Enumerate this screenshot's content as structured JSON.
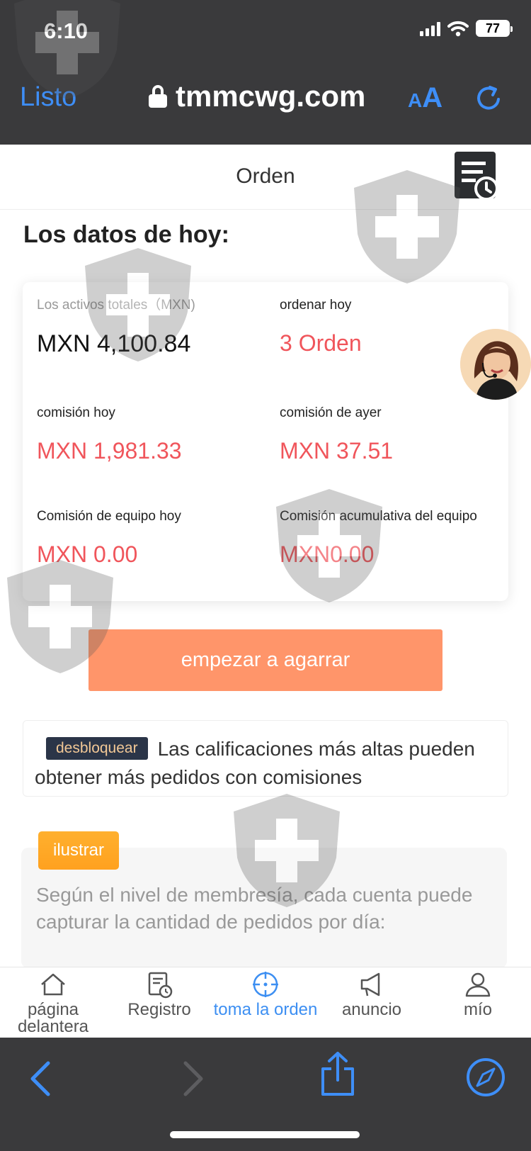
{
  "status_bar": {
    "time": "6:10",
    "battery": "77"
  },
  "browser": {
    "done_label": "Listo",
    "url": "tmmcwg.com",
    "text_size_label_small": "A",
    "text_size_label_big": "A"
  },
  "header": {
    "title": "Orden"
  },
  "section_title": "Los datos de hoy:",
  "stats": {
    "total_assets": {
      "label": "Los activos totales（MXN)",
      "value": "MXN 4,100.84"
    },
    "orders_today": {
      "label": "ordenar hoy",
      "value": "3 Orden"
    },
    "commission_today": {
      "label": "comisión hoy",
      "value": "MXN 1,981.33"
    },
    "commission_yesterday": {
      "label": "comisión de ayer",
      "value": "MXN 37.51"
    },
    "team_commission_today": {
      "label": "Comisión de equipo hoy",
      "value": "MXN 0.00"
    },
    "team_commission_cumulative": {
      "label": "Comisión acumulativa del equipo",
      "value": "MXN0.00"
    }
  },
  "grab_button": "empezar a agarrar",
  "unlock": {
    "badge": "desbloquear",
    "text": "Las calificaciones más altas pueden obtener más pedidos con comisiones"
  },
  "illustrate": {
    "badge": "ilustrar",
    "text": "Según el nivel de membresía, cada cuenta puede capturar la cantidad de pedidos por día:"
  },
  "tabs": [
    {
      "label": "página delantera",
      "icon": "home-icon",
      "active": false
    },
    {
      "label": "Registro",
      "icon": "record-icon",
      "active": false
    },
    {
      "label": "toma la orden",
      "icon": "crosshair-icon",
      "active": true
    },
    {
      "label": "anuncio",
      "icon": "megaphone-icon",
      "active": false
    },
    {
      "label": "mío",
      "icon": "user-icon",
      "active": false
    }
  ],
  "colors": {
    "accent_blue": "#3d8ff2",
    "value_red": "#f0555b",
    "grab_button": "#ff956a",
    "illustrate_badge": "#ffa11f",
    "chrome": "#3a3a3c"
  }
}
